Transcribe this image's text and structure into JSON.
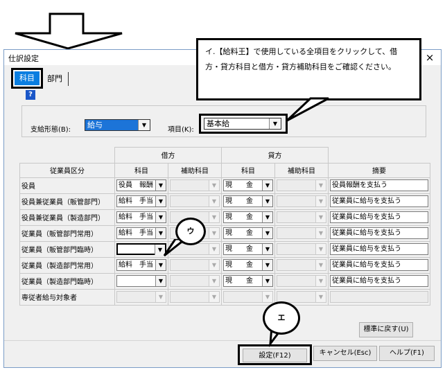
{
  "dialog": {
    "title": "仕訳設定",
    "close": "×",
    "help": "?"
  },
  "tabs": [
    {
      "label": "科目"
    },
    {
      "label": "部門"
    }
  ],
  "form": {
    "shikyu_label": "支給形態(B):",
    "shikyu_value": "給与",
    "komoku_label": "項目(K):",
    "komoku_value": "基本給"
  },
  "table": {
    "group_headers": {
      "debit": "借方",
      "credit": "貸方"
    },
    "headers": {
      "employee": "従業員区分",
      "account": "科目",
      "subaccount": "補助科目",
      "desc": "摘要"
    },
    "rows": [
      {
        "employee": "役員",
        "debit": "役員　報酬",
        "credit": "現　　金",
        "desc": "役員報酬を支払う"
      },
      {
        "employee": "役員兼従業員（販管部門）",
        "debit": "給料　手当",
        "credit": "現　　金",
        "desc": "従業員に給与を支払う"
      },
      {
        "employee": "役員兼従業員（製造部門）",
        "debit": "給料　手当",
        "credit": "現　　金",
        "desc": "従業員に給与を支払う"
      },
      {
        "employee": "従業員（販管部門常用）",
        "debit": "給料　手当",
        "credit": "現　　金",
        "desc": "従業員に給与を支払う"
      },
      {
        "employee": "従業員（販管部門臨時）",
        "debit": "",
        "credit": "現　　金",
        "desc": "従業員に給与を支払う"
      },
      {
        "employee": "従業員（製造部門常用）",
        "debit": "給料　手当",
        "credit": "現　　金",
        "desc": "従業員に給与を支払う"
      },
      {
        "employee": "従業員（製造部門臨時）",
        "debit": "",
        "credit": "現　　金",
        "desc": "従業員に給与を支払う"
      },
      {
        "employee": "専従者給与対象者",
        "debit": "",
        "credit": "",
        "desc": ""
      }
    ]
  },
  "buttons": {
    "reset": "標準に戻す(U)",
    "set": "設定(F12)",
    "cancel": "キャンセル(Esc)",
    "help": "ヘルプ(F1)"
  },
  "callouts": {
    "i_text": "イ.【給料王】で使用している全項目をクリックして、借方・貸方科目と借方・貸方補助科目をご確認ください。",
    "u": "ウ",
    "e": "エ"
  }
}
